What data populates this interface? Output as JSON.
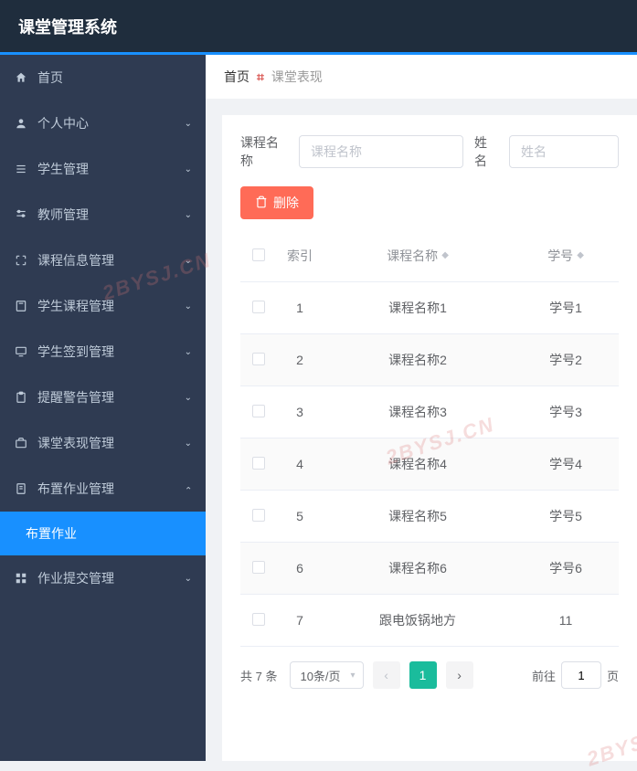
{
  "app": {
    "title": "课堂管理系统"
  },
  "sidebar": {
    "items": [
      {
        "label": "首页",
        "icon": "home",
        "expandable": false
      },
      {
        "label": "个人中心",
        "icon": "user",
        "expandable": true,
        "open": false
      },
      {
        "label": "学生管理",
        "icon": "list",
        "expandable": true,
        "open": false
      },
      {
        "label": "教师管理",
        "icon": "sliders",
        "expandable": true,
        "open": false
      },
      {
        "label": "课程信息管理",
        "icon": "fullscreen",
        "expandable": true,
        "open": false
      },
      {
        "label": "学生课程管理",
        "icon": "book",
        "expandable": true,
        "open": false
      },
      {
        "label": "学生签到管理",
        "icon": "monitor",
        "expandable": true,
        "open": false
      },
      {
        "label": "提醒警告管理",
        "icon": "clipboard",
        "expandable": true,
        "open": false
      },
      {
        "label": "课堂表现管理",
        "icon": "briefcase",
        "expandable": true,
        "open": false
      },
      {
        "label": "布置作业管理",
        "icon": "clipboard2",
        "expandable": true,
        "open": true,
        "children": [
          {
            "label": "布置作业",
            "active": true
          }
        ]
      },
      {
        "label": "作业提交管理",
        "icon": "grid",
        "expandable": true,
        "open": false
      }
    ]
  },
  "breadcrumb": {
    "home": "首页",
    "current": "课堂表现"
  },
  "filters": {
    "course_label": "课程名称",
    "course_placeholder": "课程名称",
    "name_label": "姓名",
    "name_placeholder": "姓名"
  },
  "actions": {
    "delete": "删除"
  },
  "table": {
    "headers": {
      "index": "索引",
      "course": "课程名称",
      "sno": "学号"
    },
    "rows": [
      {
        "idx": "1",
        "course": "课程名称1",
        "sno": "学号1"
      },
      {
        "idx": "2",
        "course": "课程名称2",
        "sno": "学号2"
      },
      {
        "idx": "3",
        "course": "课程名称3",
        "sno": "学号3"
      },
      {
        "idx": "4",
        "course": "课程名称4",
        "sno": "学号4"
      },
      {
        "idx": "5",
        "course": "课程名称5",
        "sno": "学号5"
      },
      {
        "idx": "6",
        "course": "课程名称6",
        "sno": "学号6"
      },
      {
        "idx": "7",
        "course": "跟电饭锅地方",
        "sno": "11"
      }
    ]
  },
  "pagination": {
    "total_text": "共 7 条",
    "page_size": "10条/页",
    "current": "1",
    "jump_prefix": "前往",
    "jump_suffix": "页",
    "jump_value": "1"
  },
  "watermark": "2BYSJ.CN"
}
